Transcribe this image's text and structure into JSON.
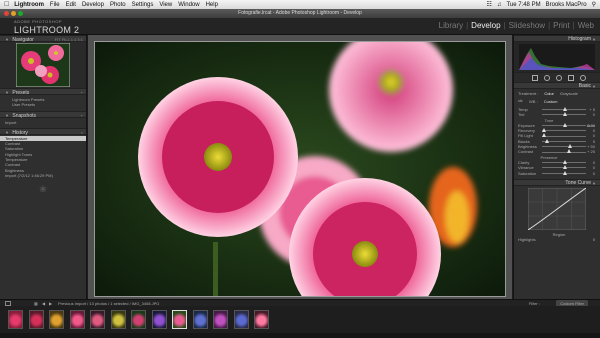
{
  "menubar": {
    "apple": "",
    "items": [
      "Lightroom",
      "File",
      "Edit",
      "Develop",
      "Photo",
      "Settings",
      "View",
      "Window",
      "Help"
    ],
    "clock": "Tue 7:48 PM",
    "user": "Brooks MacPro"
  },
  "window": {
    "title": "Fotografie.lrcat - Adobe Photoshop Lightroom - Develop"
  },
  "identity": {
    "line1": "ADOBE PHOTOSHOP",
    "line2": "LIGHTROOM 2"
  },
  "modules": {
    "library": "Library",
    "develop": "Develop",
    "slideshow": "Slideshow",
    "print": "Print",
    "web": "Web",
    "sep": "|"
  },
  "left": {
    "navigator": {
      "title": "Navigator",
      "zoom": "FIT  FILL  1:1  3:1"
    },
    "presets": {
      "title": "Presets",
      "items": [
        "Lightroom Presets",
        "User Presets"
      ]
    },
    "snapshots": {
      "title": "Snapshots",
      "items": [
        "Import"
      ]
    },
    "history": {
      "title": "History",
      "items": [
        {
          "name": "Temperature",
          "a": "",
          "b": ""
        },
        {
          "name": "Contrast",
          "a": "",
          "b": ""
        },
        {
          "name": "Saturation",
          "a": "",
          "b": ""
        },
        {
          "name": "Highlight Tones",
          "a": "",
          "b": ""
        },
        {
          "name": "Temperature",
          "a": "",
          "b": ""
        },
        {
          "name": "Contrast",
          "a": "",
          "b": ""
        },
        {
          "name": "Brightness",
          "a": "",
          "b": ""
        },
        {
          "name": "Import (7/2/12 1:46:29 PM)",
          "a": "",
          "b": ""
        }
      ]
    }
  },
  "right": {
    "histogram": {
      "title": "Histogram"
    },
    "basic": {
      "title": "Basic",
      "treatment": "Treatment :",
      "color": "Color",
      "bw": "Grayscale",
      "wb_label": "WB :",
      "wb_value": "Custom",
      "sliders": [
        {
          "label": "Temp",
          "val": "+ 5",
          "pos": 0.52
        },
        {
          "label": "Tint",
          "val": "0",
          "pos": 0.5
        },
        {
          "label": "Tone",
          "val": "Auto",
          "pos": null
        },
        {
          "label": "Exposure",
          "val": "0.00",
          "pos": 0.5
        },
        {
          "label": "Recovery",
          "val": "0",
          "pos": 0.05
        },
        {
          "label": "Fill Light",
          "val": "0",
          "pos": 0.05
        },
        {
          "label": "Blacks",
          "val": "5",
          "pos": 0.1
        },
        {
          "label": "Brightness",
          "val": "+ 50",
          "pos": 0.62
        },
        {
          "label": "Contrast",
          "val": "+ 25",
          "pos": 0.6
        },
        {
          "label": "Presence",
          "val": "",
          "pos": null
        },
        {
          "label": "Clarity",
          "val": "0",
          "pos": 0.5
        },
        {
          "label": "Vibrance",
          "val": "0",
          "pos": 0.5
        },
        {
          "label": "Saturation",
          "val": "0",
          "pos": 0.5
        }
      ]
    },
    "tonecurve": {
      "title": "Tone Curve",
      "region": "Region",
      "highlights": "Highlights",
      "hl_val": "0"
    }
  },
  "toolbar": {
    "info": "Previous Import / 13 photos / 1 selected / IMG_3408.JPG",
    "filter": "Filter :",
    "filter_value": "Custom Filter"
  },
  "filmstrip": {
    "count": 13,
    "selected_index": 8
  },
  "colors": {
    "accent": "#cfcfcf",
    "panel": "#2f2f2f",
    "canvas": "#515151"
  }
}
